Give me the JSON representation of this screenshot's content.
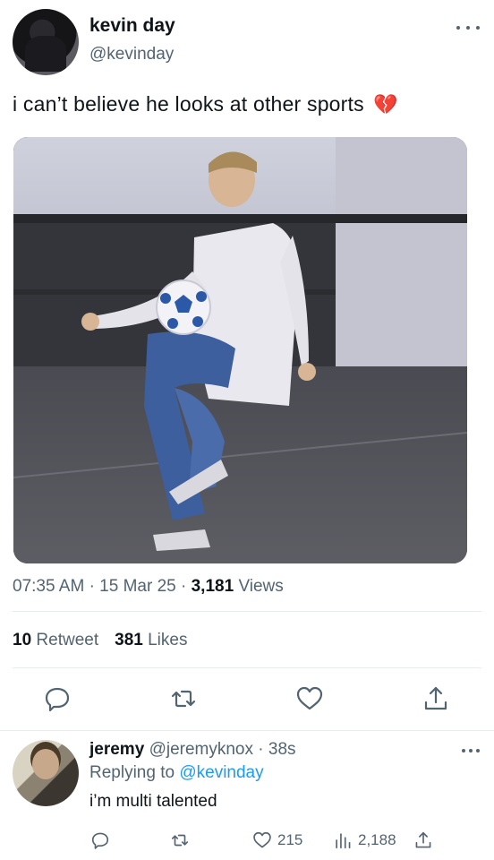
{
  "tweet": {
    "author_name": "kevin day",
    "author_handle": "@kevinday",
    "text": "i can’t believe he looks at other sports",
    "emoji": "💔",
    "time": "07:35 AM",
    "date": "15 Mar 25",
    "views_count": "3,181",
    "views_label": "Views",
    "retweet_count": "10",
    "retweet_label": "Retweet",
    "likes_count": "381",
    "likes_label": "Likes",
    "separator": "·"
  },
  "icons": {
    "more": "more-horizontal-icon",
    "reply": "reply-bubble-icon",
    "retweet": "retweet-icon",
    "like": "heart-outline-icon",
    "share": "share-upload-icon",
    "views": "analytics-bars-icon"
  },
  "reply": {
    "author_name": "jeremy",
    "author_handle": "@jeremyknox",
    "time": "38s",
    "replying_prefix": "Replying to",
    "replying_to": "@kevinday",
    "text": "i’m multi talented",
    "likes_count": "215",
    "views_count": "2,188"
  },
  "colors": {
    "text": "#0f1419",
    "secondary": "#536471",
    "link": "#1d9bf0",
    "divider": "#e6ecf0",
    "broken_heart": "#e0245e"
  }
}
